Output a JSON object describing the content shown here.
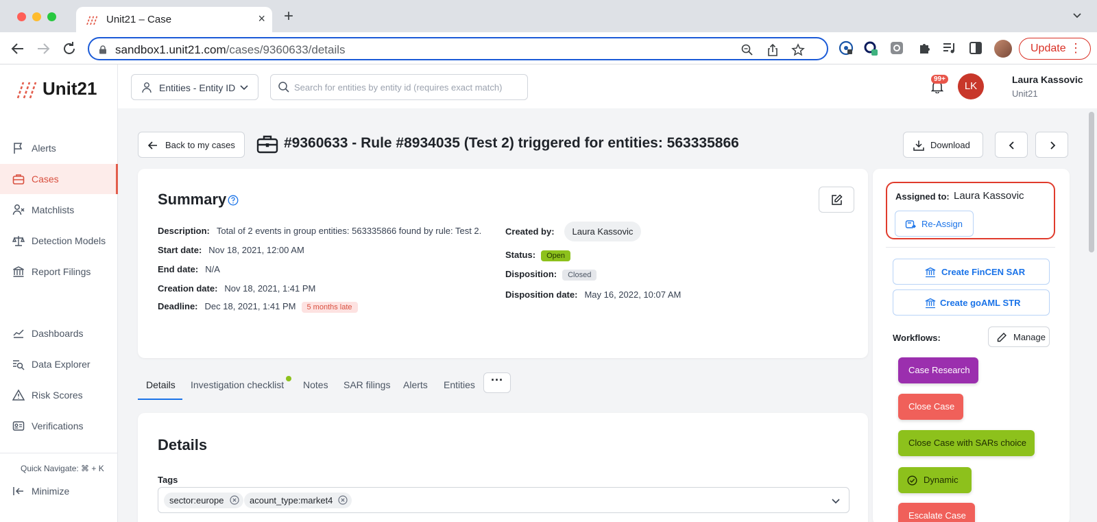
{
  "browser": {
    "tab_title": "Unit21 – Case",
    "url_host": "sandbox1.unit21.com",
    "url_path": "/cases/9360633/details",
    "update_label": "Update"
  },
  "sidebar": {
    "brand": "Unit21",
    "items": [
      {
        "label": "Alerts",
        "icon": "flag-icon"
      },
      {
        "label": "Cases",
        "icon": "briefcase-icon",
        "active": true
      },
      {
        "label": "Matchlists",
        "icon": "user-x-icon"
      },
      {
        "label": "Detection Models",
        "icon": "scale-icon"
      },
      {
        "label": "Report Filings",
        "icon": "bank-icon"
      },
      {
        "label": "Dashboards",
        "icon": "line-chart-icon"
      },
      {
        "label": "Data Explorer",
        "icon": "search-list-icon"
      },
      {
        "label": "Risk Scores",
        "icon": "warning-icon"
      },
      {
        "label": "Verifications",
        "icon": "id-card-icon"
      }
    ],
    "quick_navigate": "Quick Navigate: ⌘ + K",
    "minimize": "Minimize"
  },
  "header": {
    "entity_select": "Entities - Entity ID",
    "search_placeholder": "Search for entities by entity id (requires exact match)",
    "notifications": "99+",
    "avatar_initials": "LK",
    "user_name": "Laura Kassovic",
    "user_org": "Unit21"
  },
  "page": {
    "back_label": "Back to my cases",
    "title": "#9360633 - Rule #8934035 (Test 2) triggered for entities: 563335866",
    "download_label": "Download"
  },
  "summary": {
    "title": "Summary",
    "description_label": "Description:",
    "description": "Total of 2 events in group entities: 563335866 found by rule: Test 2.",
    "start_label": "Start date:",
    "start": "Nov 18, 2021, 12:00 AM",
    "end_label": "End date:",
    "end": "N/A",
    "creation_label": "Creation date:",
    "creation": "Nov 18, 2021, 1:41 PM",
    "deadline_label": "Deadline:",
    "deadline": "Dec 18, 2021, 1:41 PM",
    "late": "5 months late",
    "created_by_label": "Created by:",
    "created_by": "Laura Kassovic",
    "status_label": "Status:",
    "status": "Open",
    "disposition_label": "Disposition:",
    "disposition": "Closed",
    "disposition_date_label": "Disposition date:",
    "disposition_date": "May 16, 2022, 10:07 AM"
  },
  "tabs": [
    "Details",
    "Investigation checklist",
    "Notes",
    "SAR filings",
    "Alerts",
    "Entities"
  ],
  "details": {
    "title": "Details",
    "tags_label": "Tags",
    "tags": [
      "sector:europe",
      "acount_type:market4"
    ]
  },
  "right_panel": {
    "assigned_label": "Assigned to:",
    "assigned_to": "Laura Kassovic",
    "reassign_label": "Re-Assign",
    "fincen_label": "Create FinCEN SAR",
    "goaml_label": "Create goAML STR",
    "workflows_label": "Workflows:",
    "manage_label": "Manage",
    "workflows": [
      {
        "label": "Case Research",
        "color": "#9b2fae",
        "text_color": "#ffffff"
      },
      {
        "label": "Close Case",
        "color": "#f0605a",
        "text_color": "#ffffff"
      },
      {
        "label": "Close Case with SARs choice",
        "color": "#8dc11c",
        "text_color": "#1f2d00"
      },
      {
        "label": "Dynamic",
        "color": "#8dc11c",
        "text_color": "#1f2d00",
        "icon": "check-circle-icon"
      },
      {
        "label": "Escalate Case",
        "color": "#f0605a",
        "text_color": "#ffffff"
      }
    ]
  },
  "colors": {
    "accent": "#e35d4c",
    "link": "#1a73e8",
    "highlight_border": "#e03b2c"
  }
}
